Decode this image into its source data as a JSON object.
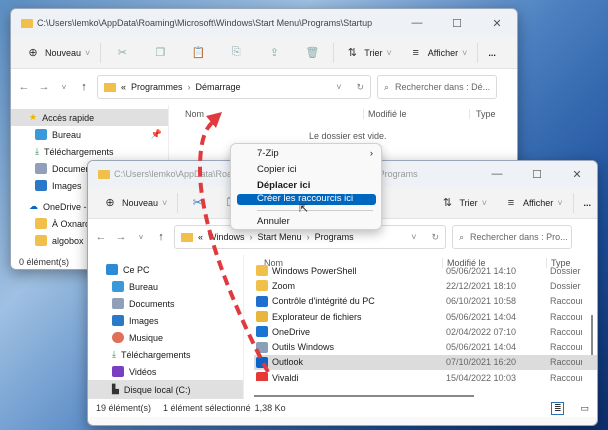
{
  "back_window": {
    "title": "C:\\Users\\lemko\\AppData\\Roaming\\Microsoft\\Windows\\Start Menu\\Programs\\Startup",
    "toolbar": {
      "new": "Nouveau",
      "sort": "Trier",
      "view": "Afficher",
      "more": "..."
    },
    "breadcrumb": [
      "«",
      "Programmes",
      "Démarrage"
    ],
    "search_placeholder": "Rechercher dans : Dé...",
    "columns": [
      "Nom",
      "Modifié le",
      "Type"
    ],
    "empty_text": "Le dossier est vide.",
    "sidebar": [
      {
        "label": "Accès rapide"
      },
      {
        "label": "Bureau"
      },
      {
        "label": "Téléchargements"
      },
      {
        "label": "Documents"
      },
      {
        "label": "Images"
      },
      {
        "label": "OneDrive - "
      },
      {
        "label": "À Oxnard"
      },
      {
        "label": "algobox"
      }
    ],
    "status": "0 élément(s)"
  },
  "front_window": {
    "title": "C:\\Users\\lemko\\AppData\\Roaming\\Microsoft\\Windows\\Start Menu\\Programs",
    "toolbar": {
      "new": "Nouveau",
      "sort": "Trier",
      "view": "Afficher",
      "more": "..."
    },
    "breadcrumb": [
      "«",
      "Windows",
      "Start Menu",
      "Programs"
    ],
    "search_placeholder": "Rechercher dans : Pro...",
    "columns": [
      "Nom",
      "Modifié le",
      "Type"
    ],
    "sidebar": [
      {
        "label": "Ce PC"
      },
      {
        "label": "Bureau"
      },
      {
        "label": "Documents"
      },
      {
        "label": "Images"
      },
      {
        "label": "Musique"
      },
      {
        "label": "Téléchargements"
      },
      {
        "label": "Vidéos"
      },
      {
        "label": "Disque local (C:)"
      }
    ],
    "rows": [
      {
        "name": "Windows PowerShell",
        "date": "05/06/2021 14:10",
        "type": "Dossier"
      },
      {
        "name": "Zoom",
        "date": "22/12/2021 18:10",
        "type": "Dossier"
      },
      {
        "name": "Contrôle d'intégrité du PC",
        "date": "06/10/2021 10:58",
        "type": "Raccourci"
      },
      {
        "name": "Explorateur de fichiers",
        "date": "05/06/2021 14:04",
        "type": "Raccourci"
      },
      {
        "name": "OneDrive",
        "date": "02/04/2022 07:10",
        "type": "Raccourci"
      },
      {
        "name": "Outils Windows",
        "date": "05/06/2021 14:04",
        "type": "Raccourci"
      },
      {
        "name": "Outlook",
        "date": "07/10/2021 16:20",
        "type": "Raccourci"
      },
      {
        "name": "Vivaldi",
        "date": "15/04/2022 10:03",
        "type": "Raccourci"
      }
    ],
    "status": {
      "count": "19 élément(s)",
      "selected": "1 élément sélectionné",
      "size": "1,38 Ko"
    }
  },
  "context_menu": {
    "items": [
      "7-Zip",
      "Copier ici",
      "Déplacer ici",
      "Créer les raccourcis ici",
      "Annuler"
    ],
    "highlight_color": "#0067c0"
  },
  "arrow_color": "#e0393e"
}
